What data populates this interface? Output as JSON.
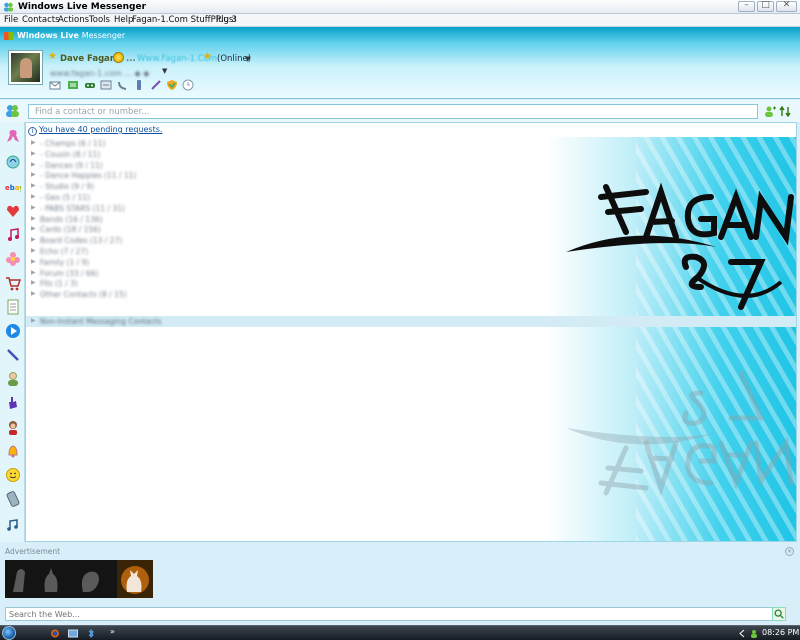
{
  "window": {
    "title": "Windows Live Messenger"
  },
  "menu": [
    "File",
    "Contacts",
    "Actions",
    "Tools",
    "Help",
    "Fagan-1.Com StuffPlug 3",
    "Plus!"
  ],
  "header": {
    "brand_bold": "Windows Live",
    "brand_rest": "Messenger",
    "nickname": "Dave Fagan",
    "nickname_dots": "...",
    "nickname_link": "Www.Fagan-1.Com",
    "status": "(Online)",
    "personal_message": "www.fagan-1.com ... ◆ ◆"
  },
  "search": {
    "placeholder": "Find a contact or number..."
  },
  "pending": {
    "text": "You have 40 pending requests."
  },
  "groups": [
    "- Champs (6 / 11)",
    "- Cousin (8 / 11)",
    "- Dances (9 / 11)",
    "- Dance Happies (11 / 11)",
    "- Studio (9 / 9)",
    "- Geo (5 / 11)",
    "- PABS STARS (11 / 31)",
    "Bands (16 / 136)",
    "Cards (18 / 156)",
    "Board Codes (13 / 27)",
    "Echo (7 / 27)",
    "Family (1 / 9)",
    "Forum (33 / 66)",
    "Fits (1 / 3)",
    "Other Contacts (8 / 15)",
    "Non-Instant Messaging Contacts"
  ],
  "advertisement": {
    "label": "Advertisement"
  },
  "websearch": {
    "placeholder": "Search the Web..."
  },
  "taskbar": {
    "more": "»",
    "clock": "08:26 PM"
  }
}
